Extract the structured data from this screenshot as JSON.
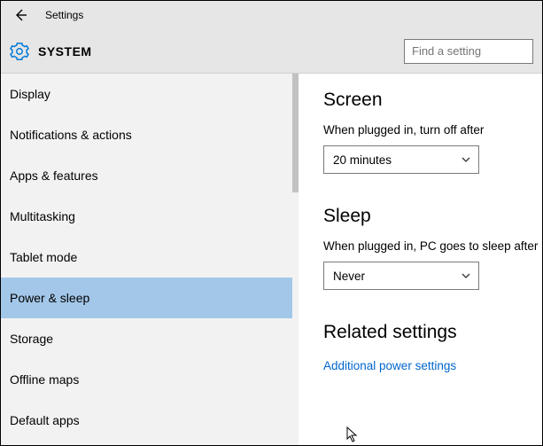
{
  "window": {
    "title": "Settings"
  },
  "page": {
    "title": "SYSTEM"
  },
  "search": {
    "placeholder": "Find a setting"
  },
  "sidebar": {
    "items": [
      {
        "label": "Display",
        "selected": false
      },
      {
        "label": "Notifications & actions",
        "selected": false
      },
      {
        "label": "Apps & features",
        "selected": false
      },
      {
        "label": "Multitasking",
        "selected": false
      },
      {
        "label": "Tablet mode",
        "selected": false
      },
      {
        "label": "Power & sleep",
        "selected": true
      },
      {
        "label": "Storage",
        "selected": false
      },
      {
        "label": "Offline maps",
        "selected": false
      },
      {
        "label": "Default apps",
        "selected": false
      }
    ]
  },
  "main": {
    "screen": {
      "title": "Screen",
      "plugged_label": "When plugged in, turn off after",
      "plugged_value": "20 minutes"
    },
    "sleep": {
      "title": "Sleep",
      "plugged_label": "When plugged in, PC goes to sleep after",
      "plugged_value": "Never"
    },
    "related": {
      "title": "Related settings",
      "link": "Additional power settings"
    }
  }
}
